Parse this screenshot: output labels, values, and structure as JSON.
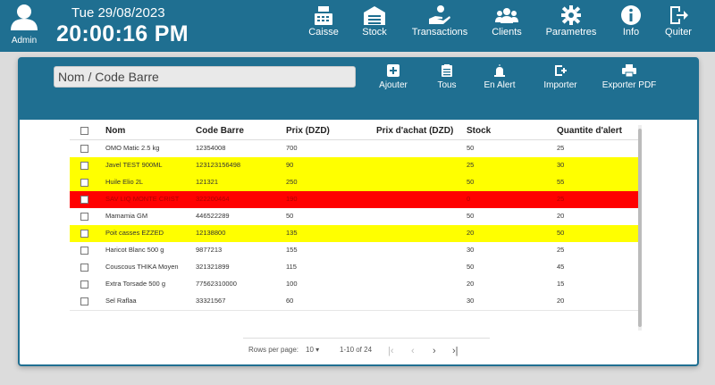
{
  "header": {
    "user_label": "Admin",
    "date": "Tue 29/08/2023",
    "time": "20:00:16 PM",
    "nav": [
      {
        "label": "Caisse",
        "icon": "cash-register-icon"
      },
      {
        "label": "Stock",
        "icon": "warehouse-icon"
      },
      {
        "label": "Transactions",
        "icon": "hand-money-icon"
      },
      {
        "label": "Clients",
        "icon": "users-icon"
      },
      {
        "label": "Parametres",
        "icon": "gear-icon"
      },
      {
        "label": "Info",
        "icon": "info-icon"
      },
      {
        "label": "Quiter",
        "icon": "logout-icon"
      }
    ]
  },
  "toolbar": {
    "search_placeholder": "Nom / Code Barre",
    "buttons": [
      {
        "label": "Ajouter",
        "icon": "plus-icon"
      },
      {
        "label": "Tous",
        "icon": "clipboard-icon"
      },
      {
        "label": "En Alert",
        "icon": "alarm-icon"
      },
      {
        "label": "Importer",
        "icon": "import-icon"
      },
      {
        "label": "Exporter PDF",
        "icon": "printer-icon"
      }
    ]
  },
  "table": {
    "columns": [
      "Nom",
      "Code Barre",
      "Prix (DZD)",
      "Prix d'achat (DZD)",
      "Stock",
      "Quantite d'alert"
    ],
    "rows": [
      {
        "nom": "OMO Matic 2.5 kg",
        "code": "12354008",
        "prix": "700",
        "achat": "",
        "stock": "50",
        "alert": "25",
        "status": "normal"
      },
      {
        "nom": "Javel TEST 900ML",
        "code": "123123156498",
        "prix": "90",
        "achat": "",
        "stock": "25",
        "alert": "30",
        "status": "warning"
      },
      {
        "nom": "Huile Elio 2L",
        "code": "121321",
        "prix": "250",
        "achat": "",
        "stock": "50",
        "alert": "55",
        "status": "warning"
      },
      {
        "nom": "SAV LIQ MONTE CRIST",
        "code": "322200464",
        "prix": "190",
        "achat": "",
        "stock": "0",
        "alert": "25",
        "status": "danger"
      },
      {
        "nom": "Mamamia GM",
        "code": "446522289",
        "prix": "50",
        "achat": "",
        "stock": "50",
        "alert": "20",
        "status": "normal"
      },
      {
        "nom": "Poit casses EZZED",
        "code": "12138800",
        "prix": "135",
        "achat": "",
        "stock": "20",
        "alert": "50",
        "status": "warning"
      },
      {
        "nom": "Haricot Blanc 500 g",
        "code": "9877213",
        "prix": "155",
        "achat": "",
        "stock": "30",
        "alert": "25",
        "status": "normal"
      },
      {
        "nom": "Couscous THIKA Moyen",
        "code": "321321899",
        "prix": "115",
        "achat": "",
        "stock": "50",
        "alert": "45",
        "status": "normal"
      },
      {
        "nom": "Extra Torsade 500 g",
        "code": "77562310000",
        "prix": "100",
        "achat": "",
        "stock": "20",
        "alert": "15",
        "status": "normal"
      },
      {
        "nom": "Sel Raflaa",
        "code": "33321567",
        "prix": "60",
        "achat": "",
        "stock": "30",
        "alert": "20",
        "status": "normal"
      }
    ],
    "status_colors": {
      "normal": "#ffffff",
      "warning": "#ffff00",
      "danger": "#ff0000"
    }
  },
  "pagination": {
    "rows_per_page_label": "Rows per page:",
    "rows_per_page": "10",
    "range": "1-10 of 24"
  },
  "colors": {
    "primary": "#1f6f91"
  }
}
